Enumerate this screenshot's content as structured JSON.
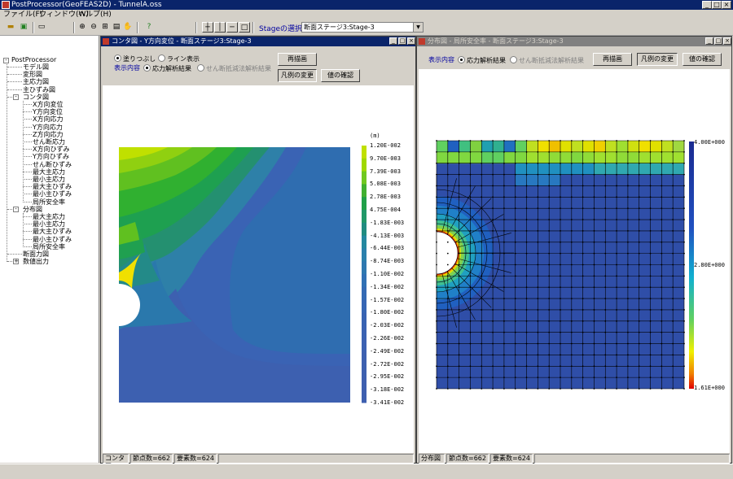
{
  "app": {
    "title": "PostProcessor(GeoFEAS2D) - TunnelA.oss"
  },
  "menu": [
    "ファイル(F)",
    "ウィンドウ(W)",
    "ヘルプ(H)"
  ],
  "toolbar": {
    "stage_label": "Stageの選択",
    "stage_value": "断面ステージ3:Stage-3"
  },
  "tree": {
    "root": "PostProcessor",
    "items": [
      "モデル図",
      "変形図",
      "主応力図",
      "主ひずみ図",
      "コンタ図",
      "X方向変位",
      "Y方向変位",
      "X方向応力",
      "Y方向応力",
      "Z方向応力",
      "せん断応力",
      "X方向ひずみ",
      "Y方向ひずみ",
      "せん断ひずみ",
      "最大主応力",
      "最小主応力",
      "最大主ひずみ",
      "最小主ひずみ",
      "局所安全率",
      "分布図",
      "最大主応力",
      "最小主応力",
      "最大主ひずみ",
      "最小主ひずみ",
      "局所安全率",
      "断面力図",
      "数値出力"
    ]
  },
  "left_window": {
    "title": "コンタ図 - Y方向変位 - 断面ステージ3:Stage-3",
    "radio_fill": "塗りつぶし",
    "radio_line": "ライン表示",
    "display_label": "表示内容",
    "radio_stress": "応力解析結果",
    "radio_shear": "せん断抵減法解析結果",
    "btn_redraw": "再描画",
    "btn_legend": "凡例の変更",
    "btn_check": "値の確認",
    "unit": "(m)",
    "legend_values": [
      "1.20E-002",
      "9.70E-003",
      "7.39E-003",
      "5.08E-003",
      "2.78E-003",
      "4.75E-004",
      "-1.83E-003",
      "-4.13E-003",
      "-6.44E-003",
      "-8.74E-003",
      "-1.10E-002",
      "-1.34E-002",
      "-1.57E-002",
      "-1.80E-002",
      "-2.03E-002",
      "-2.26E-002",
      "-2.49E-002",
      "-2.72E-002",
      "-2.95E-002",
      "-3.18E-002",
      "-3.41E-002"
    ],
    "status_type": "コンタ図",
    "status_nodes": "節点数=662",
    "status_elems": "要素数=624",
    "colors": {
      "bands": [
        "#00a000",
        "#20b020",
        "#50c020",
        "#80d020",
        "#b0e010",
        "#d8f000",
        "#60c040",
        "#30a060",
        "#209080",
        "#2080a0",
        "#3070b8",
        "#3a66b8",
        "#3d60b0"
      ]
    }
  },
  "right_window": {
    "title": "分布図 - 局所安全率 - 断面ステージ3:Stage-3",
    "display_label": "表示内容",
    "radio_stress": "応力解析結果",
    "radio_shear": "せん断抵減法解析結果",
    "btn_redraw": "再描画",
    "btn_legend": "凡例の変更",
    "btn_check": "値の確認",
    "legend_values": [
      "4.00E+000",
      "2.80E+000",
      "1.61E+000"
    ],
    "status_type": "分布図",
    "status_nodes": "節点数=662",
    "status_elems": "要素数=624"
  }
}
